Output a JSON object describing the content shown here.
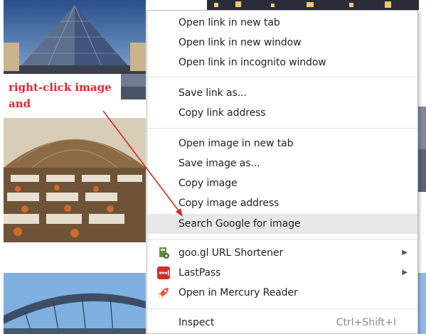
{
  "annotation": {
    "lines": [
      "right-click image",
      "and"
    ],
    "color": "#e0262b"
  },
  "context_menu": {
    "groups": [
      {
        "items": [
          {
            "label": "Open link in new tab"
          },
          {
            "label": "Open link in new window"
          },
          {
            "label": "Open link in incognito window"
          }
        ]
      },
      {
        "items": [
          {
            "label": "Save link as..."
          },
          {
            "label": "Copy link address"
          }
        ]
      },
      {
        "items": [
          {
            "label": "Open image in new tab"
          },
          {
            "label": "Save image as..."
          },
          {
            "label": "Copy image"
          },
          {
            "label": "Copy image address"
          },
          {
            "label": "Search Google for image",
            "highlighted": true
          }
        ]
      },
      {
        "items": [
          {
            "label": "goo.gl URL Shortener",
            "icon": "goo-gl-shortener-icon",
            "submenu": true
          },
          {
            "label": "LastPass",
            "icon": "lastpass-icon",
            "submenu": true
          },
          {
            "label": "Open in Mercury Reader",
            "icon": "mercury-reader-rocket-icon"
          }
        ]
      },
      {
        "items": [
          {
            "label": "Inspect",
            "shortcut": "Ctrl+Shift+I"
          }
        ]
      }
    ],
    "highlight_color": "#e8e8e8"
  },
  "background_images": [
    {
      "name": "louvre-pyramid-photo"
    },
    {
      "name": "market-hall-photo"
    },
    {
      "name": "bridge-photo"
    },
    {
      "name": "city-night-photo"
    }
  ]
}
